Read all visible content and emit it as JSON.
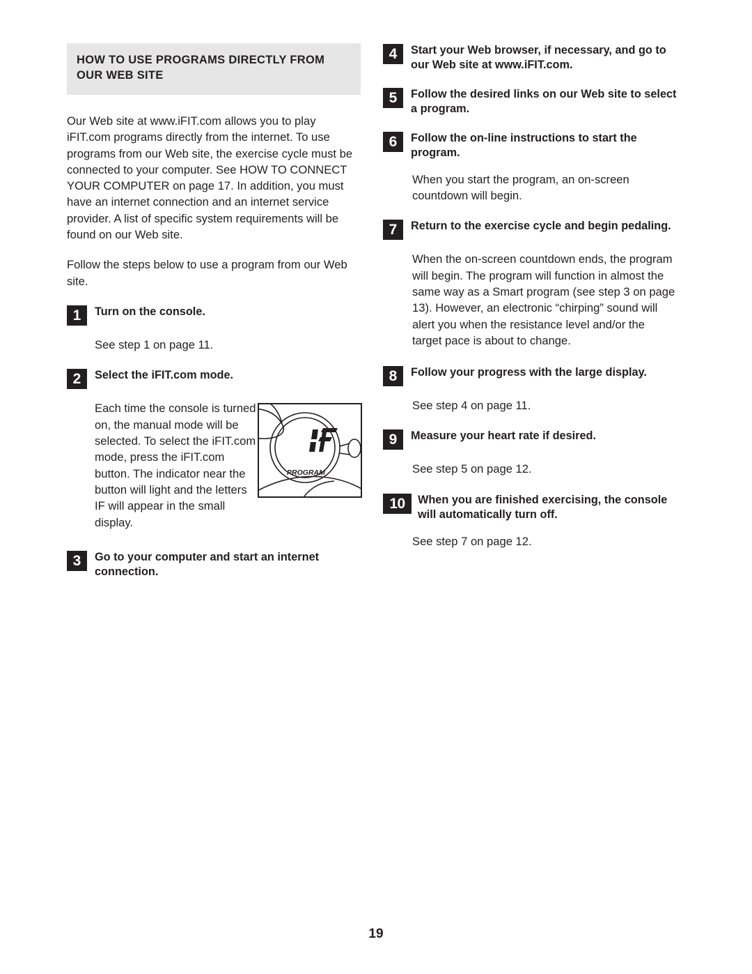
{
  "page_number": "19",
  "left_column": {
    "header_title": "HOW TO USE PROGRAMS DIRECTLY FROM OUR WEB SITE",
    "intro_paragraph": "Our Web site at www.iFIT.com allows you to play iFIT.com programs directly from the internet. To use programs from our Web site, the exercise cycle must be connected to your computer. See HOW TO CONNECT YOUR COMPUTER on page 17. In addition, you must have an internet connection and an internet service provider. A list of specific system requirements will be found on our Web site.",
    "instruction_paragraph": "Follow the steps below to use a program from our Web site.",
    "steps": [
      {
        "number": "1",
        "title": "Turn on the console.",
        "body": "See step 1 on page 11."
      },
      {
        "number": "2",
        "title": "Select the iFIT.com mode.",
        "body": "Each time the console is turned on, the manual mode will be selected. To select the iFIT.com mode, press the iFIT.com button. The indicator near the button will light and the letters IF will appear in the small display."
      },
      {
        "number": "3",
        "title": "Go to your computer and start an internet connection.",
        "body": ""
      }
    ],
    "figure": {
      "display_value": "IF",
      "display_label": "PROGRAM"
    }
  },
  "right_column": {
    "steps": [
      {
        "number": "4",
        "title": "Start your Web browser, if necessary, and go to our Web site at www.iFIT.com.",
        "body": ""
      },
      {
        "number": "5",
        "title": "Follow the desired links on our Web site to select a program.",
        "body": ""
      },
      {
        "number": "6",
        "title": "Follow the on-line instructions to start the program.",
        "body": "When you start the program, an on-screen countdown will begin."
      },
      {
        "number": "7",
        "title": "Return to the exercise cycle and begin pedaling.",
        "body": "When the on-screen countdown ends, the program will begin. The program will function in almost the same way as a Smart program (see step 3 on page 13). However, an electronic “chirping” sound will alert you when the resistance level and/or the target pace is about to change."
      },
      {
        "number": "8",
        "title": "Follow your progress with the large display.",
        "body": "See step 4 on page 11."
      },
      {
        "number": "9",
        "title": "Measure your heart rate if desired.",
        "body": "See step 5 on page 12."
      },
      {
        "number": "10",
        "title": "When you are finished exercising, the console will automatically turn off.",
        "body": "See step 7 on page 12."
      }
    ]
  },
  "colors": {
    "header_band": "#e6e6e6",
    "text": "#231f20",
    "badge_background": "#231f20",
    "badge_text": "#ffffff"
  }
}
